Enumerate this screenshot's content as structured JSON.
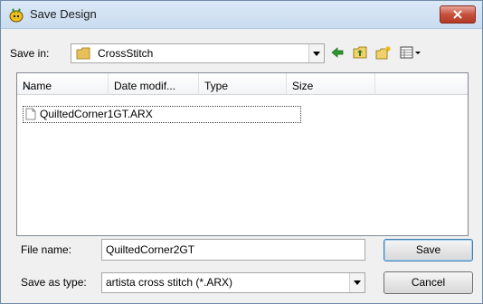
{
  "window": {
    "title": "Save Design"
  },
  "save_in": {
    "label": "Save in:",
    "value": "CrossStitch"
  },
  "toolbar": {
    "icons": [
      "back-arrow-icon",
      "up-folder-icon",
      "new-folder-icon",
      "view-menu-icon"
    ]
  },
  "list": {
    "columns": [
      "Name",
      "Date modif...",
      "Type",
      "Size"
    ],
    "files": [
      {
        "name": "QuiltedCorner1GT.ARX"
      }
    ]
  },
  "file_name": {
    "label": "File name:",
    "value": "QuiltedCorner2GT"
  },
  "save_as_type": {
    "label": "Save as type:",
    "value": "artista cross stitch (*.ARX)"
  },
  "buttons": {
    "save": "Save",
    "cancel": "Cancel"
  },
  "colors": {
    "close_button": "#c7513d",
    "folder": "#e8c05a",
    "toolbar_accent": "#e9b300"
  }
}
